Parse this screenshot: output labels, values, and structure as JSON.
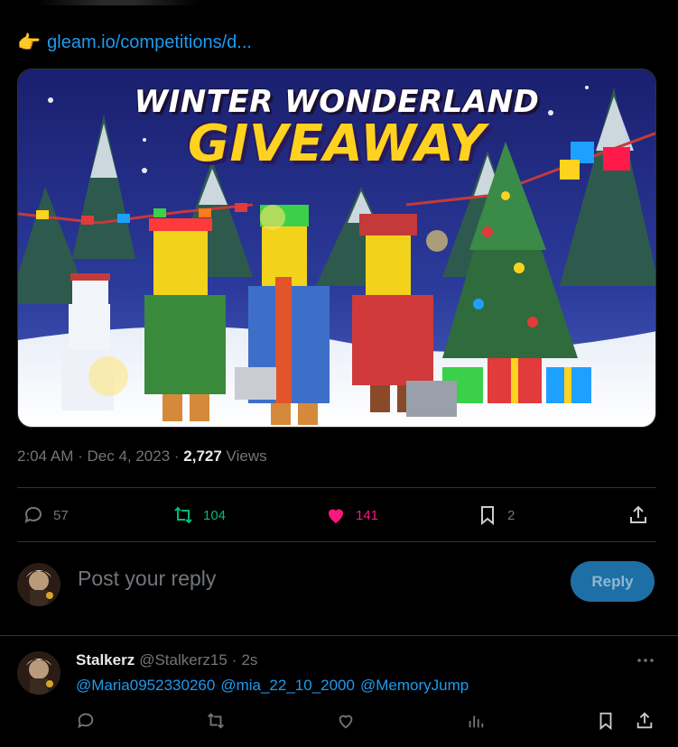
{
  "tweet": {
    "link_emoji": "👉",
    "link_text": "gleam.io/competitions/d...",
    "media": {
      "title_line1": "WINTER WONDERLAND",
      "title_line2": "GIVEAWAY"
    },
    "time": "2:04 AM",
    "sep": " · ",
    "date": "Dec 4, 2023",
    "views_count": "2,727",
    "views_label": " Views",
    "actions": {
      "replies": "57",
      "reposts": "104",
      "likes": "141",
      "bookmarks": "2"
    }
  },
  "composer": {
    "placeholder": "Post your reply",
    "button": "Reply"
  },
  "reply": {
    "name": "Stalkerz",
    "handle": "@Stalkerz15",
    "dot": "·",
    "time": "2s",
    "mentions": [
      "@Maria0952330260",
      "@mia_22_10_2000",
      "@MemoryJump"
    ]
  },
  "colors": {
    "accent": "#1d9bf0",
    "repost": "#00ba7c",
    "like": "#f91880",
    "muted": "#71767b",
    "border": "#2f3336"
  },
  "icons": [
    "pointing-hand-emoji",
    "reply-icon",
    "repost-icon",
    "heart-icon",
    "bookmark-icon",
    "share-icon",
    "more-icon",
    "analytics-icon"
  ]
}
